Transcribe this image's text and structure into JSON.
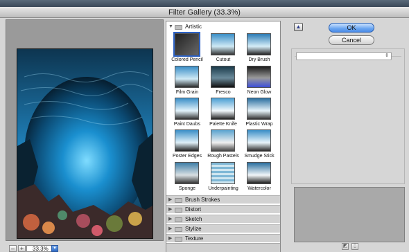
{
  "window": {
    "title": "Filter Gallery (33.3%)"
  },
  "zoom": {
    "minus": "–",
    "plus": "+",
    "value": "33.3%"
  },
  "categories": {
    "artistic": "Artistic",
    "closed": [
      "Brush Strokes",
      "Distort",
      "Sketch",
      "Stylize",
      "Texture"
    ]
  },
  "artistic_filters": [
    "Colored Pencil",
    "Cutout",
    "Dry Brush",
    "Film Grain",
    "Fresco",
    "Neon Glow",
    "Paint Daubs",
    "Palette Knife",
    "Plastic Wrap",
    "Poster Edges",
    "Rough Pastels",
    "Smudge Stick",
    "Sponge",
    "Underpainting",
    "Watercolor"
  ],
  "selected_filter": "Colored Pencil",
  "buttons": {
    "ok": "OK",
    "cancel": "Cancel"
  },
  "colors": {
    "accent": "#4b8ce8",
    "preview_bg": "#9a9a9a",
    "water": "#1a8fcf"
  }
}
